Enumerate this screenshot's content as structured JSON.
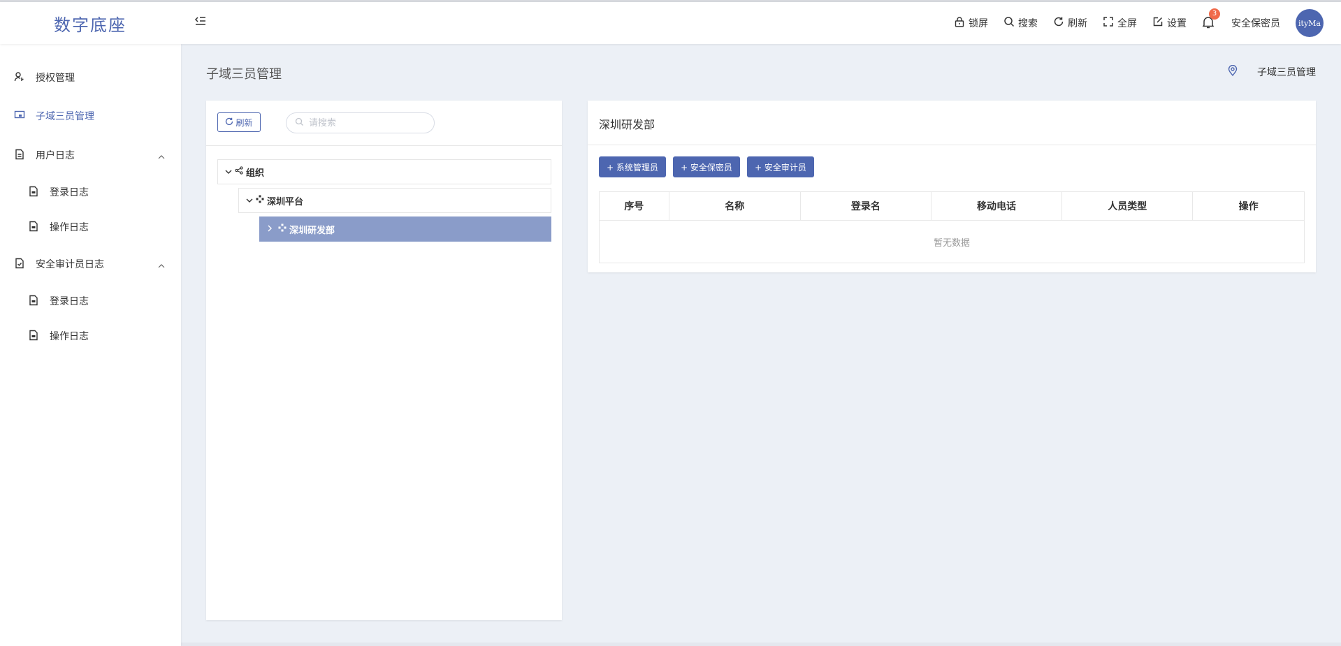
{
  "header": {
    "logo": "数字底座",
    "actions": [
      {
        "label": "锁屏",
        "icon": "lock-icon"
      },
      {
        "label": "搜索",
        "icon": "search-icon"
      },
      {
        "label": "刷新",
        "icon": "refresh-icon"
      },
      {
        "label": "全屏",
        "icon": "fullscreen-icon"
      },
      {
        "label": "设置",
        "icon": "edit-settings-icon"
      }
    ],
    "notification_count": "3",
    "username": "安全保密员",
    "avatar_text": "ityMa"
  },
  "sidebar": {
    "items": [
      {
        "label": "授权管理",
        "icon": "user-key-icon"
      },
      {
        "label": "子域三员管理",
        "icon": "subdomain-icon",
        "active": true
      },
      {
        "label": "用户日志",
        "icon": "document-icon",
        "expanded": true,
        "children": [
          {
            "label": "登录日志",
            "icon": "document-icon"
          },
          {
            "label": "操作日志",
            "icon": "document-icon"
          }
        ]
      },
      {
        "label": "安全审计员日志",
        "icon": "document-check-icon",
        "expanded": true,
        "children": [
          {
            "label": "登录日志",
            "icon": "document-icon"
          },
          {
            "label": "操作日志",
            "icon": "document-icon"
          }
        ]
      }
    ]
  },
  "page": {
    "title": "子域三员管理",
    "breadcrumb": "子域三员管理"
  },
  "left_panel": {
    "refresh_label": "刷新",
    "search_placeholder": "请搜索",
    "tree": [
      {
        "label": "组织",
        "expanded": true
      },
      {
        "label": "深圳平台",
        "expanded": true
      },
      {
        "label": "深圳研发部",
        "expanded": false,
        "selected": true
      }
    ]
  },
  "right_panel": {
    "title": "深圳研发部",
    "buttons": [
      "+ 系统管理员",
      "+ 安全保密员",
      "+ 安全审计员"
    ],
    "table": {
      "columns": [
        "序号",
        "名称",
        "登录名",
        "移动电话",
        "人员类型",
        "操作"
      ],
      "rows": [],
      "empty_text": "暂无数据"
    }
  },
  "colors": {
    "accent": "#4d66b0",
    "selected_node": "#8a9cc9",
    "badge": "#f06a4a",
    "background": "#ecf0f6"
  }
}
